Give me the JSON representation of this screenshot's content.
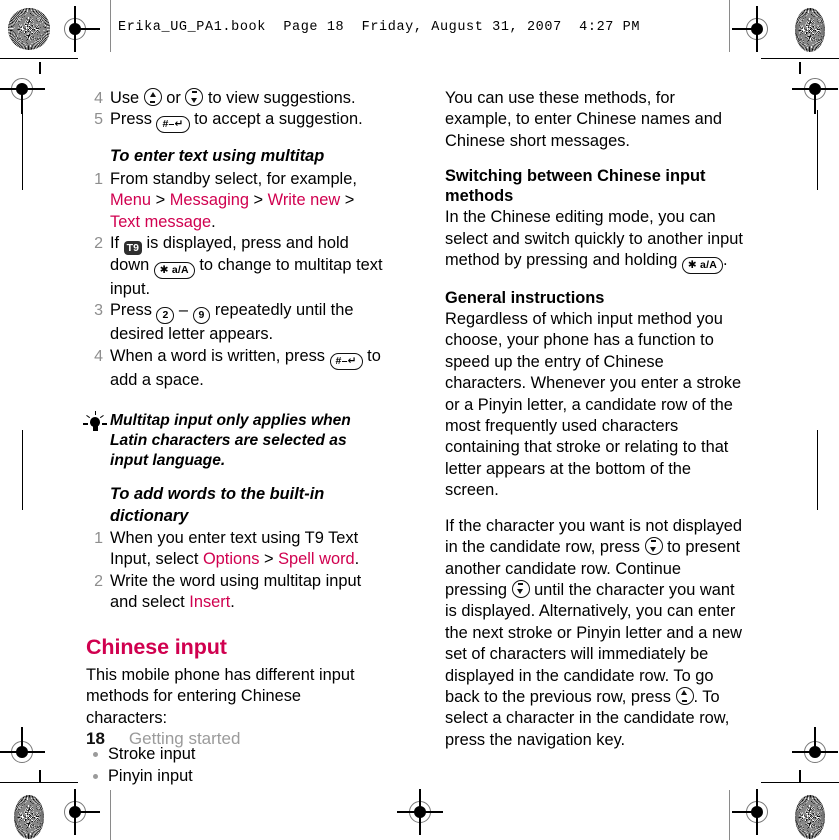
{
  "header": {
    "slug": "Erika_UG_PA1.book  Page 18  Friday, August 31, 2007  4:27 PM"
  },
  "colors": {
    "accent_pink": "#d0004f",
    "step_number_gray": "#8e8e8e",
    "footer_gray": "#9b9b9b"
  },
  "left_column": {
    "continued_steps": [
      {
        "num": "4",
        "text_before": "Use ",
        "key1": "nav-up-key",
        "text_mid": " or ",
        "key2": "nav-down-key",
        "text_after": " to view suggestions."
      },
      {
        "num": "5",
        "text_before": "Press ",
        "key1": "hash-key",
        "text_after": " to accept a suggestion."
      }
    ],
    "section_multitap": {
      "heading": "To enter text using multitap",
      "steps": [
        {
          "num": "1",
          "parts": [
            {
              "type": "text",
              "value": "From standby select, for example, "
            },
            {
              "type": "link",
              "value": "Menu"
            },
            {
              "type": "sep",
              "value": " > "
            },
            {
              "type": "link",
              "value": "Messaging"
            },
            {
              "type": "sep",
              "value": " > "
            },
            {
              "type": "link",
              "value": "Write new"
            },
            {
              "type": "sep",
              "value": " > "
            },
            {
              "type": "link",
              "value": "Text message"
            },
            {
              "type": "text",
              "value": "."
            }
          ]
        },
        {
          "num": "2",
          "parts": [
            {
              "type": "text",
              "value": "If "
            },
            {
              "type": "icon",
              "value": "t9-indicator-icon"
            },
            {
              "type": "text",
              "value": " is displayed, press and hold down "
            },
            {
              "type": "icon",
              "value": "star-key"
            },
            {
              "type": "text",
              "value": " to change to multitap text input."
            }
          ]
        },
        {
          "num": "3",
          "parts": [
            {
              "type": "text",
              "value": "Press "
            },
            {
              "type": "icon",
              "value": "key-2"
            },
            {
              "type": "text",
              "value": " – "
            },
            {
              "type": "icon",
              "value": "key-9"
            },
            {
              "type": "text",
              "value": " repeatedly until the desired letter appears."
            }
          ]
        },
        {
          "num": "4",
          "parts": [
            {
              "type": "text",
              "value": "When a word is written, press "
            },
            {
              "type": "icon",
              "value": "hash-key"
            },
            {
              "type": "text",
              "value": " to add a space."
            }
          ]
        }
      ]
    },
    "tip": {
      "icon": "lightbulb-icon",
      "text": "Multitap input only applies when Latin characters are selected as input language."
    },
    "section_dictionary": {
      "heading": "To add words to the built-in dictionary",
      "steps": [
        {
          "num": "1",
          "parts": [
            {
              "type": "text",
              "value": "When you enter text using T9 Text Input, select "
            },
            {
              "type": "link",
              "value": "Options"
            },
            {
              "type": "sep",
              "value": " > "
            },
            {
              "type": "link",
              "value": "Spell word"
            },
            {
              "type": "text",
              "value": "."
            }
          ]
        },
        {
          "num": "2",
          "parts": [
            {
              "type": "text",
              "value": "Write the word using multitap input and select "
            },
            {
              "type": "link",
              "value": "Insert"
            },
            {
              "type": "text",
              "value": "."
            }
          ]
        }
      ]
    },
    "section_chinese": {
      "heading": "Chinese input",
      "intro": "This mobile phone has different input methods for entering Chinese characters:",
      "bullets": [
        "Stroke input",
        "Pinyin input"
      ]
    }
  },
  "right_column": {
    "intro_paragraph": "You can use these methods, for example, to enter Chinese names and Chinese short messages.",
    "switching": {
      "heading": "Switching between Chinese input methods",
      "body_before": "In the Chinese editing mode, you can select and switch quickly to another input method by pressing and holding ",
      "key": "star-key",
      "body_after": "."
    },
    "general": {
      "heading": "General instructions",
      "paragraph1": "Regardless of which input method you choose, your phone has a function to speed up the entry of Chinese characters. Whenever you enter a stroke or a Pinyin letter, a candidate row of the most frequently used characters containing that stroke or relating to that letter appears at the bottom of the screen.",
      "paragraph2_parts": [
        {
          "type": "text",
          "value": "If the character you want is not displayed in the candidate row, press "
        },
        {
          "type": "icon",
          "value": "nav-down-key"
        },
        {
          "type": "text",
          "value": " to present another candidate row. Continue pressing "
        },
        {
          "type": "icon",
          "value": "nav-down-key"
        },
        {
          "type": "text",
          "value": " until the character you want is displayed. Alternatively, you can enter the next stroke or Pinyin letter and a new set of characters will immediately be displayed in the candidate row. To go back to the previous row, press "
        },
        {
          "type": "icon",
          "value": "nav-up-key"
        },
        {
          "type": "text",
          "value": ". To select a character in the candidate row, press the navigation key."
        }
      ]
    }
  },
  "key_glyphs": {
    "hash_key": "#–↵",
    "star_key": "✱ a/A",
    "key_2": "2",
    "key_9": "9",
    "t9_label": "T9"
  },
  "footer": {
    "page_number": "18",
    "chapter": "Getting started"
  }
}
